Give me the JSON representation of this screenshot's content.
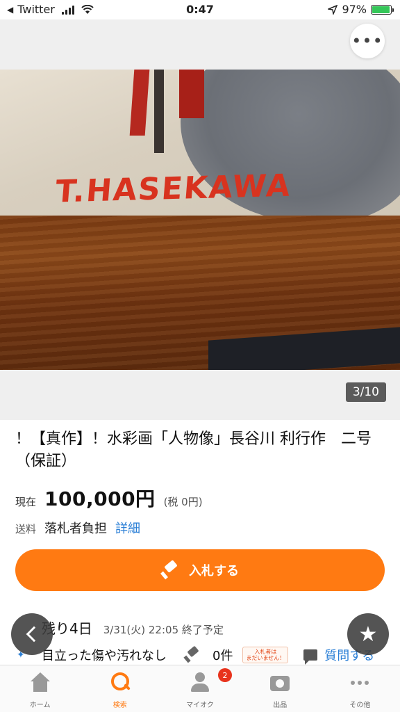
{
  "status_bar": {
    "back_app": "Twitter",
    "time": "0:47",
    "battery_pct": "97%",
    "battery_level": 0.97
  },
  "gallery": {
    "image_signature_text": "T.HASEKAWA",
    "counter": "3/10",
    "more_icon": "ellipsis-icon"
  },
  "item": {
    "title": "！【真作】！水彩画「人物像」長谷川 利行作　二号（保証）",
    "price_label": "現在",
    "price": "100,000円",
    "tax": "(税 0円)",
    "shipping_label": "送料",
    "shipping_value": "落札者負担",
    "shipping_detail": "詳細",
    "bid_button": "入札する",
    "remaining": "残り4日",
    "end_time": "3/31(火) 22:05 終了予定",
    "condition": "目立った傷や汚れなし",
    "bid_count": "0件",
    "no_bids_badge_line1": "入札者は",
    "no_bids_badge_line2": "まだいません！",
    "question_link": "質問する"
  },
  "tabbar": {
    "tabs": [
      {
        "label": "ホーム",
        "icon": "home-icon"
      },
      {
        "label": "検索",
        "icon": "search-icon"
      },
      {
        "label": "マイオク",
        "icon": "person-icon",
        "badge": "2"
      },
      {
        "label": "出品",
        "icon": "camera-icon"
      },
      {
        "label": "その他",
        "icon": "dots-icon"
      }
    ]
  },
  "colors": {
    "accent": "#ff7a12",
    "link": "#2b7fd6",
    "badge": "#e8331c"
  }
}
